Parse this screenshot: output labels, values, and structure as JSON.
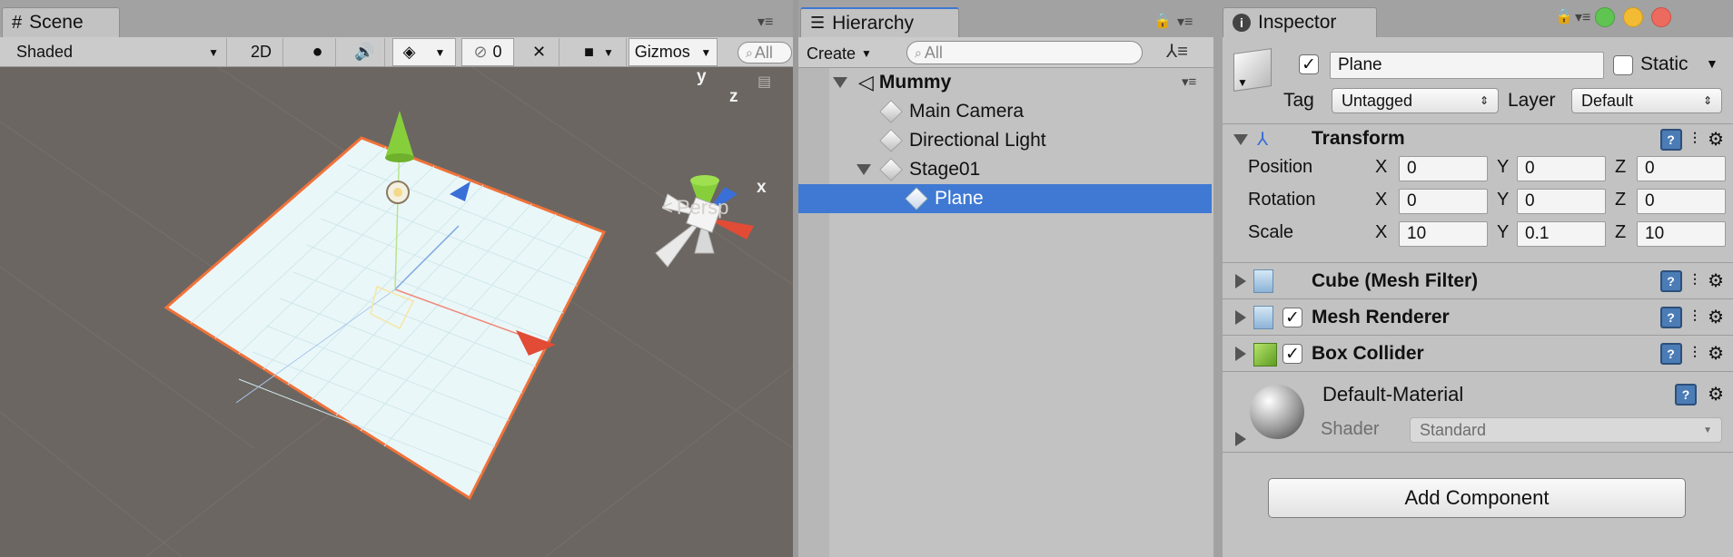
{
  "scene": {
    "tab_label": "Scene",
    "shading_mode": "Shaded",
    "mode_2d": "2D",
    "hidden_count": "0",
    "gizmos_label": "Gizmos",
    "search_placeholder": "All",
    "persp_label": "Persp",
    "axis_y": "y",
    "axis_z": "z",
    "axis_x": "x"
  },
  "hierarchy": {
    "tab_label": "Hierarchy",
    "create_label": "Create",
    "search_placeholder": "All",
    "scene_name": "Mummy",
    "items": [
      {
        "label": "Main Camera"
      },
      {
        "label": "Directional Light"
      },
      {
        "label": "Stage01"
      },
      {
        "label": "Plane",
        "selected": true
      }
    ]
  },
  "inspector": {
    "tab_label": "Inspector",
    "object_name": "Plane",
    "active": true,
    "static_label": "Static",
    "tag_label": "Tag",
    "tag_value": "Untagged",
    "layer_label": "Layer",
    "layer_value": "Default",
    "transform": {
      "title": "Transform",
      "rows": [
        {
          "label": "Position",
          "x": "0",
          "y": "0",
          "z": "0"
        },
        {
          "label": "Rotation",
          "x": "0",
          "y": "0",
          "z": "0"
        },
        {
          "label": "Scale",
          "x": "10",
          "y": "0.1",
          "z": "10"
        }
      ],
      "axis_x": "X",
      "axis_y": "Y",
      "axis_z": "Z"
    },
    "mesh_filter": {
      "title": "Cube (Mesh Filter)"
    },
    "mesh_renderer": {
      "title": "Mesh Renderer",
      "enabled": true
    },
    "box_collider": {
      "title": "Box Collider",
      "enabled": true
    },
    "material": {
      "name": "Default-Material",
      "shader_label": "Shader",
      "shader_value": "Standard"
    },
    "add_component_label": "Add Component"
  },
  "colors": {
    "selection": "#3f79d3",
    "scene_bg": "#6b6661",
    "plane_fill": "#eaf7f8",
    "plane_outline": "#f0723a",
    "gizmo_red": "#e24b36",
    "gizmo_green": "#86cf3b",
    "gizmo_blue": "#3a6fd8"
  }
}
